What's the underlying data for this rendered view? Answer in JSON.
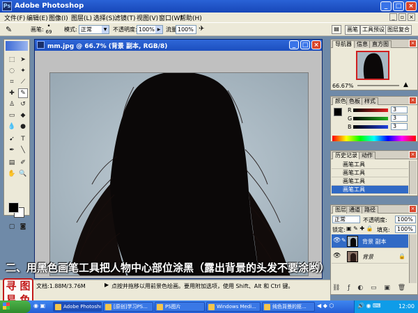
{
  "app": {
    "title": "Adobe Photoshop"
  },
  "menubar": [
    "文件(F)",
    "编辑(E)",
    "图像(I)",
    "图层(L)",
    "选择(S)",
    "滤镜(T)",
    "视图(V)",
    "窗口(W)",
    "帮助(H)"
  ],
  "options": {
    "brush_label": "画笔:",
    "brush_size": "69",
    "mode_label": "模式:",
    "mode_value": "正常",
    "opacity_label": "不透明度:",
    "opacity_value": "100%",
    "flow_label": "流量:",
    "flow_value": "100%",
    "well_tabs": [
      "画笔",
      "工具预设",
      "图层复合"
    ]
  },
  "document": {
    "title": "mm.jpg @ 66.7% (背景 副本, RGB/8)"
  },
  "caption": "二、用黑色画笔工具把人物中心部位涂黑（露出背景的头发不要涂哟）",
  "status": {
    "doc_size": "文档:1.88M/3.76M",
    "hint": "点按并拖移以用前景色绘画。要用附加选项，使用 Shift、Alt 和 Ctrl 键。"
  },
  "seal": [
    "寻",
    "图",
    "易",
    "色"
  ],
  "navigator": {
    "tabs": [
      "导航器",
      "信息",
      "直方图"
    ],
    "zoom": "66.67%"
  },
  "color": {
    "tabs": [
      "颜色",
      "色板",
      "样式"
    ],
    "channels": [
      {
        "label": "R",
        "value": "3",
        "color": "#e02020"
      },
      {
        "label": "G",
        "value": "3",
        "color": "#20b020"
      },
      {
        "label": "B",
        "value": "3",
        "color": "#2040e0"
      }
    ]
  },
  "history": {
    "tabs": [
      "历史记录",
      "动作"
    ],
    "items": [
      "画笔工具",
      "画笔工具",
      "画笔工具",
      "画笔工具"
    ]
  },
  "layers": {
    "tabs": [
      "图层",
      "通道",
      "路径"
    ],
    "blend": "正常",
    "opacity_label": "不透明度:",
    "opacity_value": "100%",
    "lock_label": "锁定:",
    "fill_label": "填充:",
    "fill_value": "100%",
    "rows": [
      "背景 副本",
      "背景"
    ]
  },
  "taskbar": {
    "items": [
      "Adobe Photoshop",
      "[原创]学习PS...",
      "PS图片",
      "Windows Medi...",
      "纯色背景的抠..."
    ],
    "clock": "12:00"
  }
}
